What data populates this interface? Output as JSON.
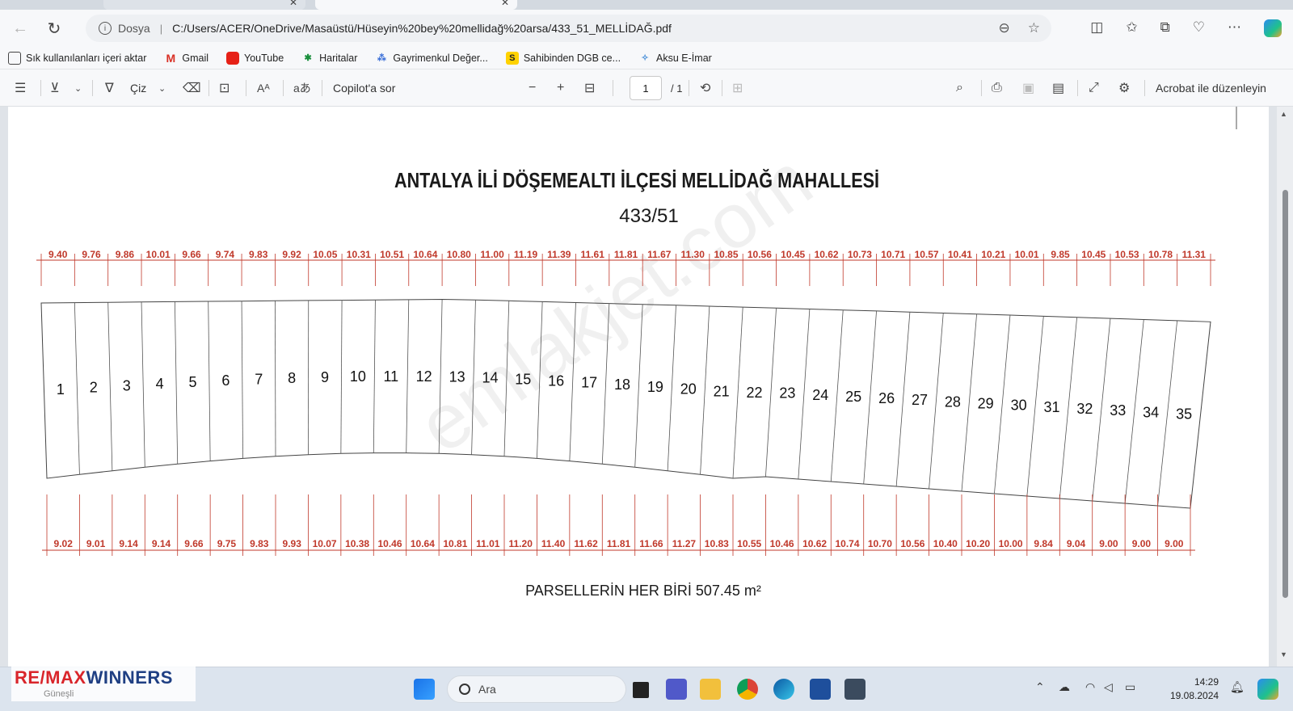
{
  "browser": {
    "url_scheme_label": "Dosya",
    "url_path": "C:/Users/ACER/OneDrive/Masaüstü/Hüseyin%20bey%20mellidağ%20arsa/433_51_MELLİDAĞ.pdf"
  },
  "bookmarks": [
    {
      "label": "Sık kullanılanları içeri aktar",
      "icon": "import-icon"
    },
    {
      "label": "Gmail",
      "icon": "gmail-icon"
    },
    {
      "label": "YouTube",
      "icon": "youtube-icon"
    },
    {
      "label": "Haritalar",
      "icon": "maps-icon"
    },
    {
      "label": "Gayrimenkul Değer...",
      "icon": "gayrimenkul-icon"
    },
    {
      "label": "Sahibinden DGB ce...",
      "icon": "sahibinden-icon"
    },
    {
      "label": "Aksu E-İmar",
      "icon": "aksu-icon"
    }
  ],
  "pdf_toolbar": {
    "draw_label": "Çiz",
    "copilot_label": "Copilot'a sor",
    "page_current": "1",
    "page_total": "/ 1",
    "acrobat_label": "Acrobat ile düzenleyin"
  },
  "document": {
    "title": "ANTALYA İLİ DÖŞEMEALTI İLÇESİ MELLİDAĞ MAHALLESİ",
    "parcel_id": "433/51",
    "footer_note": "PARSELLERİN HER BİRİ 507.45 m²",
    "watermark": "emlakjet.com",
    "parcel_numbers": [
      "1",
      "2",
      "3",
      "4",
      "5",
      "6",
      "7",
      "8",
      "9",
      "10",
      "11",
      "12",
      "13",
      "14",
      "15",
      "16",
      "17",
      "18",
      "19",
      "20",
      "21",
      "22",
      "23",
      "24",
      "25",
      "26",
      "27",
      "28",
      "29",
      "30",
      "31",
      "32",
      "33",
      "34",
      "35"
    ],
    "top_widths": [
      "9.40",
      "9.76",
      "9.86",
      "10.01",
      "9.66",
      "9.74",
      "9.83",
      "9.92",
      "10.05",
      "10.31",
      "10.51",
      "10.64",
      "10.80",
      "11.00",
      "11.19",
      "11.39",
      "11.61",
      "11.81",
      "11.67",
      "11.30",
      "10.85",
      "10.56",
      "10.45",
      "10.62",
      "10.73",
      "10.71",
      "10.57",
      "10.41",
      "10.21",
      "10.01",
      "9.85",
      "10.45",
      "10.53",
      "10.78",
      "11.31"
    ],
    "bottom_widths": [
      "9.02",
      "9.01",
      "9.14",
      "9.14",
      "9.66",
      "9.75",
      "9.83",
      "9.93",
      "10.07",
      "10.38",
      "10.46",
      "10.64",
      "10.81",
      "11.01",
      "11.20",
      "11.40",
      "11.62",
      "11.81",
      "11.66",
      "11.27",
      "10.83",
      "10.55",
      "10.46",
      "10.62",
      "10.74",
      "10.70",
      "10.56",
      "10.40",
      "10.20",
      "10.00",
      "9.84",
      "9.04",
      "9.00",
      "9.00",
      "9.00"
    ]
  },
  "taskbar": {
    "search_placeholder": "Ara",
    "time": "14:29",
    "date": "19.08.2024"
  },
  "overlay": {
    "brand_left": "RE/MAX",
    "brand_right": "WINNERS",
    "sub": "Güneşli"
  }
}
